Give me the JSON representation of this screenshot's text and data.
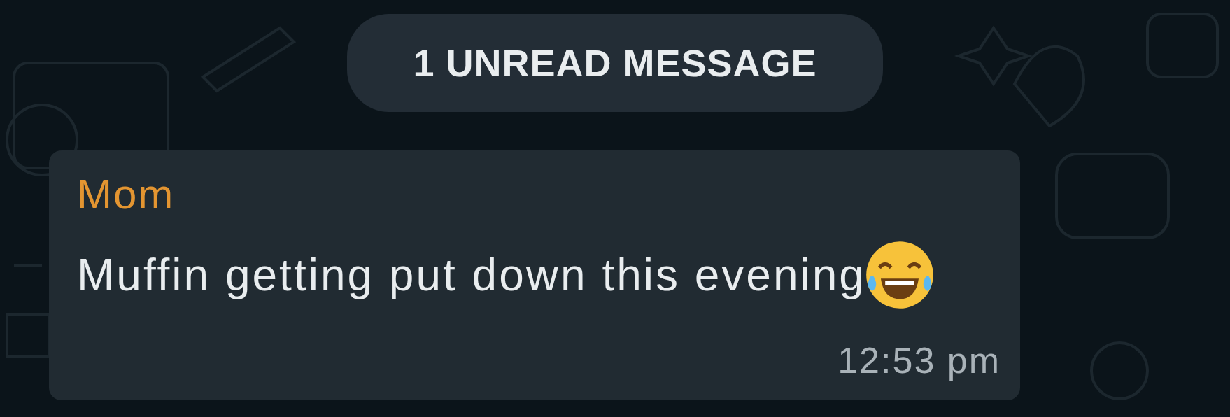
{
  "unread_banner": {
    "text": "1 UNREAD MESSAGE"
  },
  "message": {
    "sender": "Mom",
    "text": "Muffin getting put down this evening",
    "time": "12:53 pm"
  }
}
